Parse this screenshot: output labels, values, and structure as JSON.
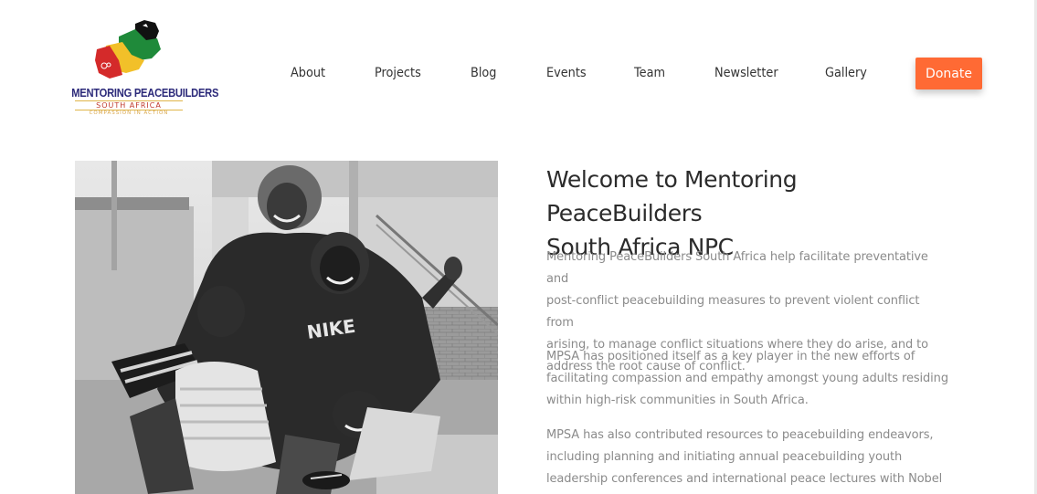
{
  "logo": {
    "title": "MENTORING PEACEBUILDERS",
    "subtitle": "SOUTH AFRICA",
    "tagline": "COMPASSION IN ACTION"
  },
  "nav": {
    "items": [
      {
        "label": "About"
      },
      {
        "label": "Projects"
      },
      {
        "label": "Blog"
      },
      {
        "label": "Events"
      },
      {
        "label": "Team"
      },
      {
        "label": "Newsletter"
      },
      {
        "label": "Gallery"
      }
    ],
    "donate_label": "Donate"
  },
  "welcome": {
    "title_line1": "Welcome to Mentoring PeaceBuilders",
    "title_line2": "South Africa NPC",
    "paragraphs": [
      [
        "Mentoring PeaceBuilders South Africa help facilitate preventative and",
        "post-conflict peacebuilding measures to prevent violent conflict from",
        "arising, to manage conflict situations where they do arise, and to",
        "address the root cause of conflict."
      ],
      [
        "MPSA has positioned itself as a key player in the new efforts of",
        "facilitating compassion and empathy amongst young adults residing",
        "within high-risk communities in South Africa."
      ],
      [
        "MPSA has also contributed resources to peacebuilding endeavors,",
        "including planning and initiating annual peacebuilding youth",
        "leadership conferences and international peace lectures with Nobel"
      ]
    ]
  },
  "photo": {
    "shirt_text": "NIKE"
  },
  "colors": {
    "accent": "#ff6a34",
    "logo_navy": "#2c2a7a",
    "text_dark": "#2b2b2b",
    "text_muted": "#8b8b8b"
  }
}
